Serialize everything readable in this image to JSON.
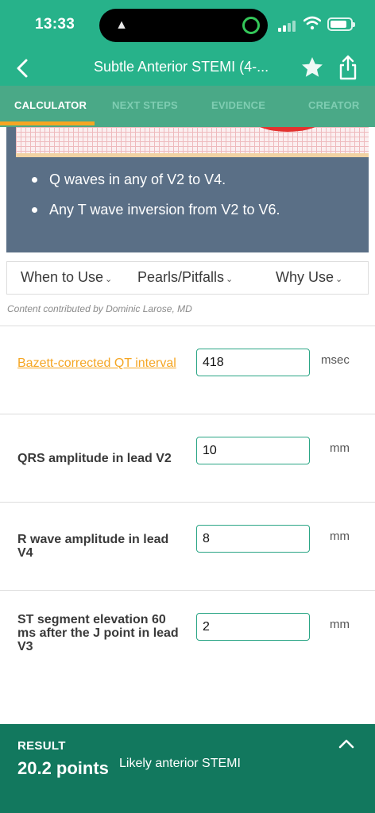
{
  "status_bar": {
    "time": "13:33"
  },
  "navbar": {
    "title": "Subtle Anterior STEMI (4-..."
  },
  "tabs": [
    {
      "label": "CALCULATOR",
      "active": true
    },
    {
      "label": "NEXT STEPS",
      "active": false
    },
    {
      "label": "EVIDENCE",
      "active": false
    },
    {
      "label": "CREATOR",
      "active": false
    }
  ],
  "criteria": [
    "Q waves in any of V2 to V4.",
    "Any T wave inversion from V2 to V6."
  ],
  "info_tabs": [
    "When to Use",
    "Pearls/Pitfalls",
    "Why Use"
  ],
  "credit": "Content contributed by Dominic Larose, MD",
  "fields": [
    {
      "label": "Bazett-corrected QT interval",
      "value": "418",
      "unit": "msec"
    },
    {
      "label": "QRS amplitude in lead V2",
      "value": "10",
      "unit": "mm"
    },
    {
      "label": "R wave amplitude in lead V4",
      "value": "8",
      "unit": "mm"
    },
    {
      "label": "ST segment elevation 60 ms after the J point in lead V3",
      "value": "2",
      "unit": "mm"
    }
  ],
  "result": {
    "label": "RESULT",
    "points": "20.2 points",
    "interpretation": "Likely anterior STEMI"
  },
  "colors": {
    "brand_green": "#27b28a",
    "tab_bar": "#4aa987",
    "accent_orange": "#f5a623",
    "result_bg": "#12785e"
  }
}
